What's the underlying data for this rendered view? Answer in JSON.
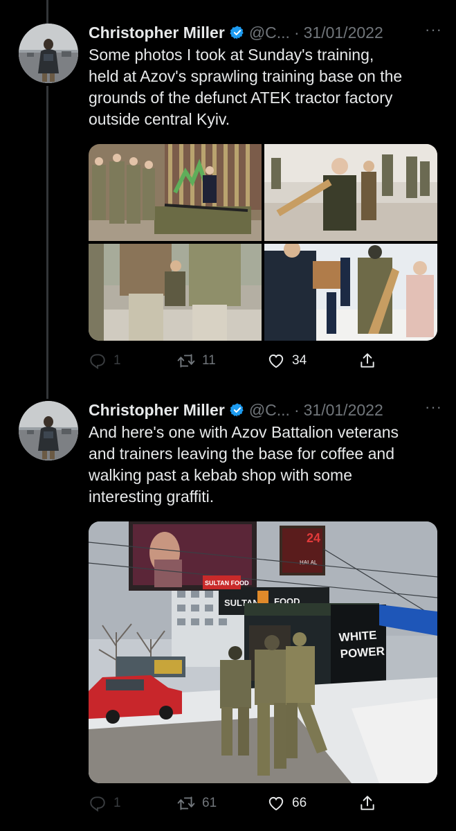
{
  "tweets": [
    {
      "author_name": "Christopher Miller",
      "handle": "@C...",
      "separator": "·",
      "date": "31/01/2022",
      "more": "···",
      "text": "Some photos I took at Sunday's training,\nheld at Azov's sprawling training base on the\ngrounds of the defunct ATEK tractor factory\noutside central Kyiv.",
      "media_type": "grid-4",
      "counts": {
        "replies": "1",
        "retweets": "11",
        "likes": "34"
      }
    },
    {
      "author_name": "Christopher Miller",
      "handle": "@C...",
      "separator": "·",
      "date": "31/01/2022",
      "more": "···",
      "text": "And here's one with Azov Battalion veterans\nand trainers leaving the base for coffee and\nwalking past a kebab shop with some\ninteresting graffiti.",
      "media_type": "single",
      "counts": {
        "replies": "1",
        "retweets": "61",
        "likes": "66"
      }
    }
  ],
  "photo_signs": {
    "sultan_food": "SULTAN FOOD",
    "sultan_food_sign": "SULTAN",
    "food": "FOOD",
    "halal_24": "24",
    "halal": "HALAL",
    "graffiti_1": "WHITE",
    "graffiti_2": "POWER"
  },
  "icons": {
    "verified": "verified-badge-icon",
    "reply": "reply-icon",
    "retweet": "retweet-icon",
    "like": "heart-icon",
    "share": "share-icon"
  },
  "colors": {
    "background": "#000000",
    "text_primary": "#e7e9ea",
    "text_secondary": "#71767b",
    "verified": "#1d9bf0",
    "thread_line": "#333639"
  }
}
